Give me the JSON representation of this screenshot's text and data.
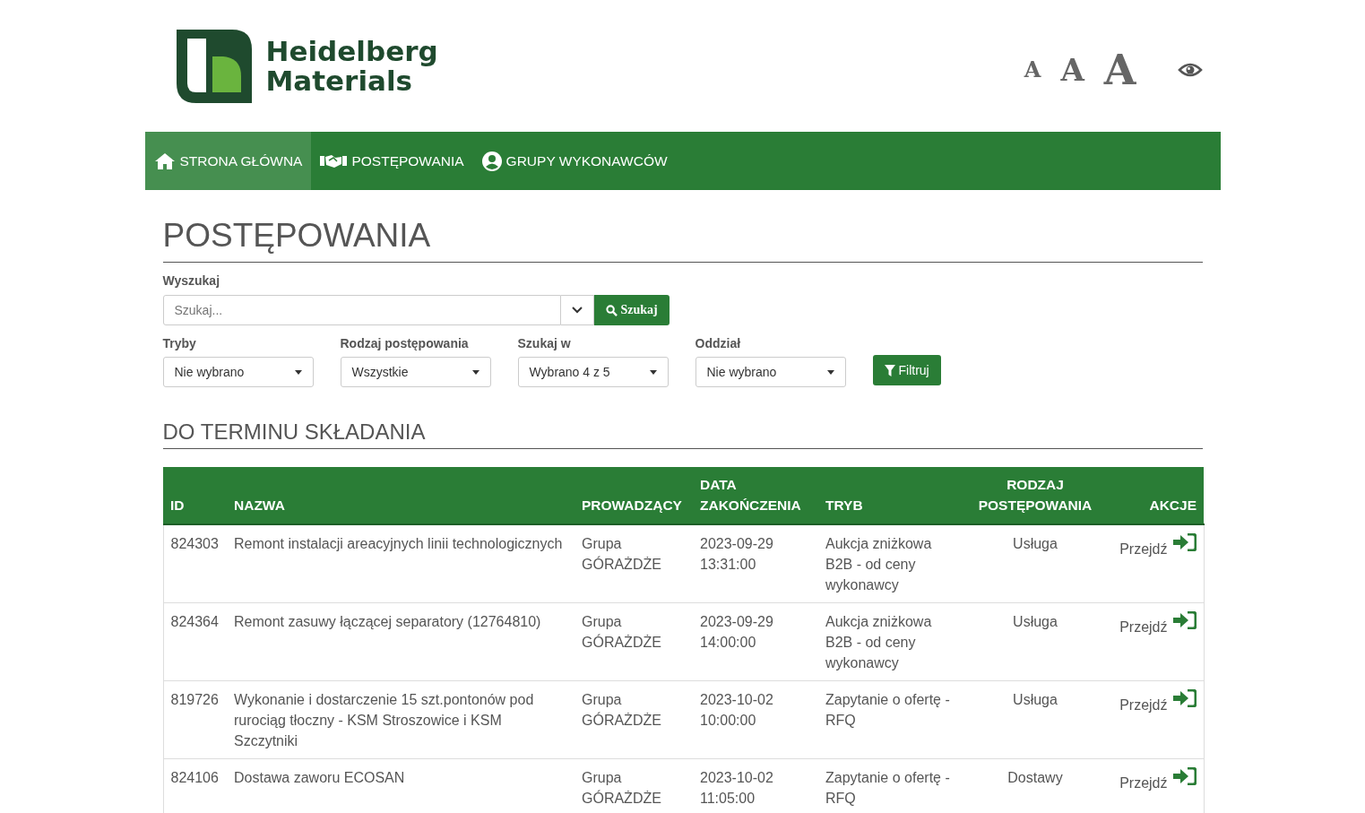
{
  "logo": {
    "line1": "Heidelberg",
    "line2": "Materials"
  },
  "font_sizes": [
    {
      "label": "A",
      "kind": "small"
    },
    {
      "label": "A",
      "kind": "medium"
    },
    {
      "label": "A",
      "kind": "large"
    }
  ],
  "nav": [
    {
      "label": "STRONA GŁÓWNA",
      "kind": "home",
      "selected": true
    },
    {
      "label": "POSTĘPOWANIA",
      "kind": "handshake",
      "selected": false
    },
    {
      "label": "GRUPY WYKONAWCÓW",
      "kind": "user",
      "selected": false
    }
  ],
  "page_title": "POSTĘPOWANIA",
  "search": {
    "label": "Wyszukaj",
    "placeholder": "Szukaj...",
    "button": "Szukaj"
  },
  "filters": [
    {
      "label": "Tryby",
      "value": "Nie wybrano"
    },
    {
      "label": "Rodzaj postępowania",
      "value": "Wszystkie"
    },
    {
      "label": "Szukaj w",
      "value": "Wybrano 4 z 5"
    },
    {
      "label": "Oddział",
      "value": "Nie wybrano"
    }
  ],
  "filter_button": "Filtruj",
  "section_title": "DO TERMINU SKŁADANIA",
  "table": {
    "columns": [
      [
        "ID"
      ],
      [
        "NAZWA"
      ],
      [
        "PROWADZĄCY"
      ],
      [
        "DATA",
        "ZAKOŃCZENIA"
      ],
      [
        "TRYB"
      ],
      [
        "RODZAJ",
        "POSTĘPOWANIA"
      ],
      [
        "AKCJE"
      ]
    ],
    "rows": [
      {
        "id": "824303",
        "name": "Remont instalacji areacyjnych linii technologicznych",
        "lead": [
          "Grupa",
          "GÓRAŻDŻE"
        ],
        "date": [
          "2023-09-29",
          "13:31:00"
        ],
        "mode": [
          "Aukcja zniżkowa",
          "B2B - od ceny",
          "wykonawcy"
        ],
        "type": "Usługa",
        "action": "Przejdź"
      },
      {
        "id": "824364",
        "name": "Remont zasuwy łączącej separatory (12764810)",
        "lead": [
          "Grupa",
          "GÓRAŻDŻE"
        ],
        "date": [
          "2023-09-29",
          "14:00:00"
        ],
        "mode": [
          "Aukcja zniżkowa",
          "B2B - od ceny",
          "wykonawcy"
        ],
        "type": "Usługa",
        "action": "Przejdź"
      },
      {
        "id": "819726",
        "name": "Wykonanie i dostarczenie 15 szt.pontonów pod rurociąg tłoczny - KSM Stroszowice i KSM Szczytniki",
        "lead": [
          "Grupa",
          "GÓRAŻDŻE"
        ],
        "date": [
          "2023-10-02",
          "10:00:00"
        ],
        "mode": [
          "Zapytanie o ofertę -",
          "RFQ"
        ],
        "type": "Usługa",
        "action": "Przejdź"
      },
      {
        "id": "824106",
        "name": "Dostawa zaworu ECOSAN",
        "lead": [
          "Grupa",
          "GÓRAŻDŻE"
        ],
        "date": [
          "2023-10-02",
          "11:05:00"
        ],
        "mode": [
          "Zapytanie o ofertę -",
          "RFQ"
        ],
        "type": "Dostawy",
        "action": "Przejdź"
      }
    ]
  }
}
